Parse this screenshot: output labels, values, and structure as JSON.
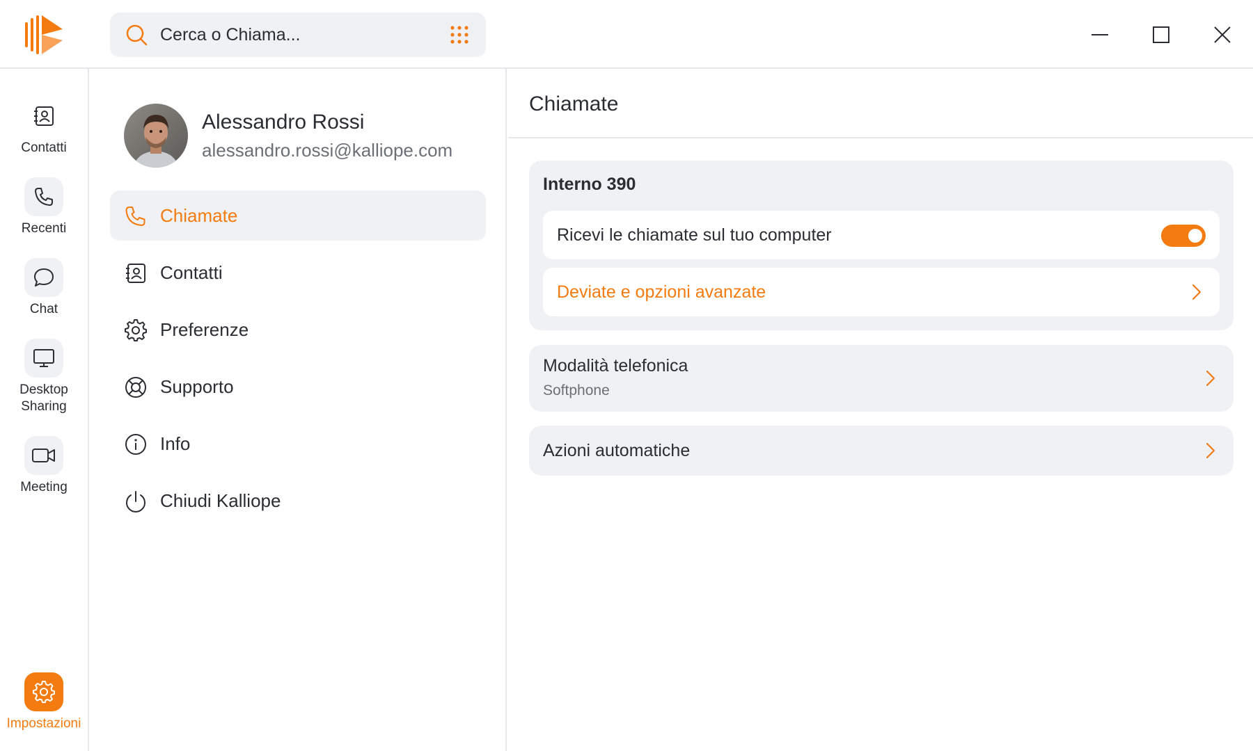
{
  "app": {
    "logo_icon": "kalliope-logo",
    "accent": "#f47b0f"
  },
  "search": {
    "placeholder": "Cerca o Chiama...",
    "icon": "search-icon",
    "dialpad_icon": "dialpad-icon"
  },
  "window_controls": [
    "minimize",
    "maximize",
    "close"
  ],
  "rail": {
    "items": [
      {
        "label": "Contatti",
        "icon": "contacts-icon"
      },
      {
        "label": "Recenti",
        "icon": "phone-icon"
      },
      {
        "label": "Chat",
        "icon": "chat-icon"
      },
      {
        "label_line1": "Desktop",
        "label_line2": "Sharing",
        "icon": "monitor-icon"
      },
      {
        "label": "Meeting",
        "icon": "video-icon"
      }
    ],
    "settings": {
      "label": "Impostazioni",
      "icon": "gear-icon",
      "active": true
    }
  },
  "user": {
    "name": "Alessandro Rossi",
    "email": "alessandro.rossi@kalliope.com"
  },
  "menu": {
    "items": [
      {
        "label": "Chiamate",
        "icon": "phone-icon",
        "active": true
      },
      {
        "label": "Contatti",
        "icon": "contacts-icon"
      },
      {
        "label": "Preferenze",
        "icon": "gear-icon"
      },
      {
        "label": "Supporto",
        "icon": "lifebuoy-icon"
      },
      {
        "label": "Info",
        "icon": "info-icon"
      },
      {
        "label": "Chiudi Kalliope",
        "icon": "power-icon"
      }
    ]
  },
  "content": {
    "title": "Chiamate",
    "extension_card": {
      "title": "Interno 390",
      "receive_calls_label": "Ricevi le chiamate sul tuo computer",
      "receive_calls_enabled": true,
      "forward_label": "Deviate e opzioni avanzate"
    },
    "phone_mode": {
      "title": "Modalità telefonica",
      "value": "Softphone"
    },
    "auto_actions": {
      "title": "Azioni automatiche"
    }
  }
}
